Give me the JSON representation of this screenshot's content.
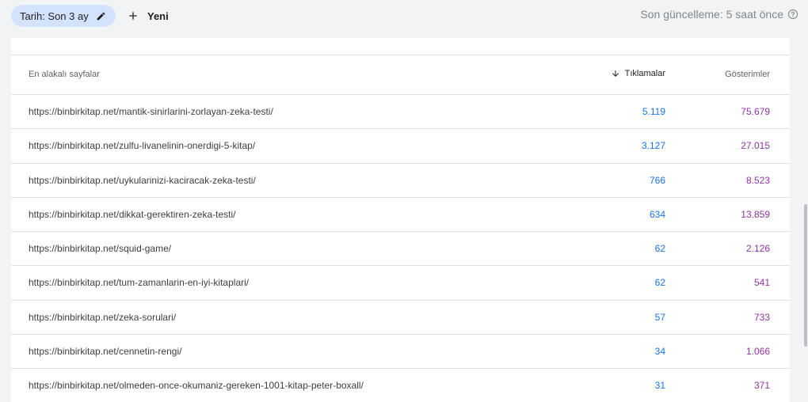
{
  "filters": {
    "date_chip_label": "Tarih: Son 3 ay",
    "new_label": "Yeni"
  },
  "last_update": "Son güncelleme: 5 saat önce",
  "table": {
    "headers": {
      "pages": "En alakalı sayfalar",
      "clicks": "Tıklamalar",
      "impressions": "Gösterimler"
    },
    "sort_icon": "arrow-down-icon",
    "rows": [
      {
        "url": "https://binbirkitap.net/mantik-sinirlarini-zorlayan-zeka-testi/",
        "clicks": "5.119",
        "impressions": "75.679"
      },
      {
        "url": "https://binbirkitap.net/zulfu-livanelinin-onerdigi-5-kitap/",
        "clicks": "3.127",
        "impressions": "27.015"
      },
      {
        "url": "https://binbirkitap.net/uykularinizi-kaciracak-zeka-testi/",
        "clicks": "766",
        "impressions": "8.523"
      },
      {
        "url": "https://binbirkitap.net/dikkat-gerektiren-zeka-testi/",
        "clicks": "634",
        "impressions": "13.859"
      },
      {
        "url": "https://binbirkitap.net/squid-game/",
        "clicks": "62",
        "impressions": "2.126"
      },
      {
        "url": "https://binbirkitap.net/tum-zamanlarin-en-iyi-kitaplari/",
        "clicks": "62",
        "impressions": "541"
      },
      {
        "url": "https://binbirkitap.net/zeka-sorulari/",
        "clicks": "57",
        "impressions": "733"
      },
      {
        "url": "https://binbirkitap.net/cennetin-rengi/",
        "clicks": "34",
        "impressions": "1.066"
      },
      {
        "url": "https://binbirkitap.net/olmeden-once-okumaniz-gereken-1001-kitap-peter-boxall/",
        "clicks": "31",
        "impressions": "371"
      }
    ]
  },
  "colors": {
    "chip_bg": "#d3e3fd",
    "clicks": "#1a73e8",
    "impressions": "#9334a6"
  }
}
